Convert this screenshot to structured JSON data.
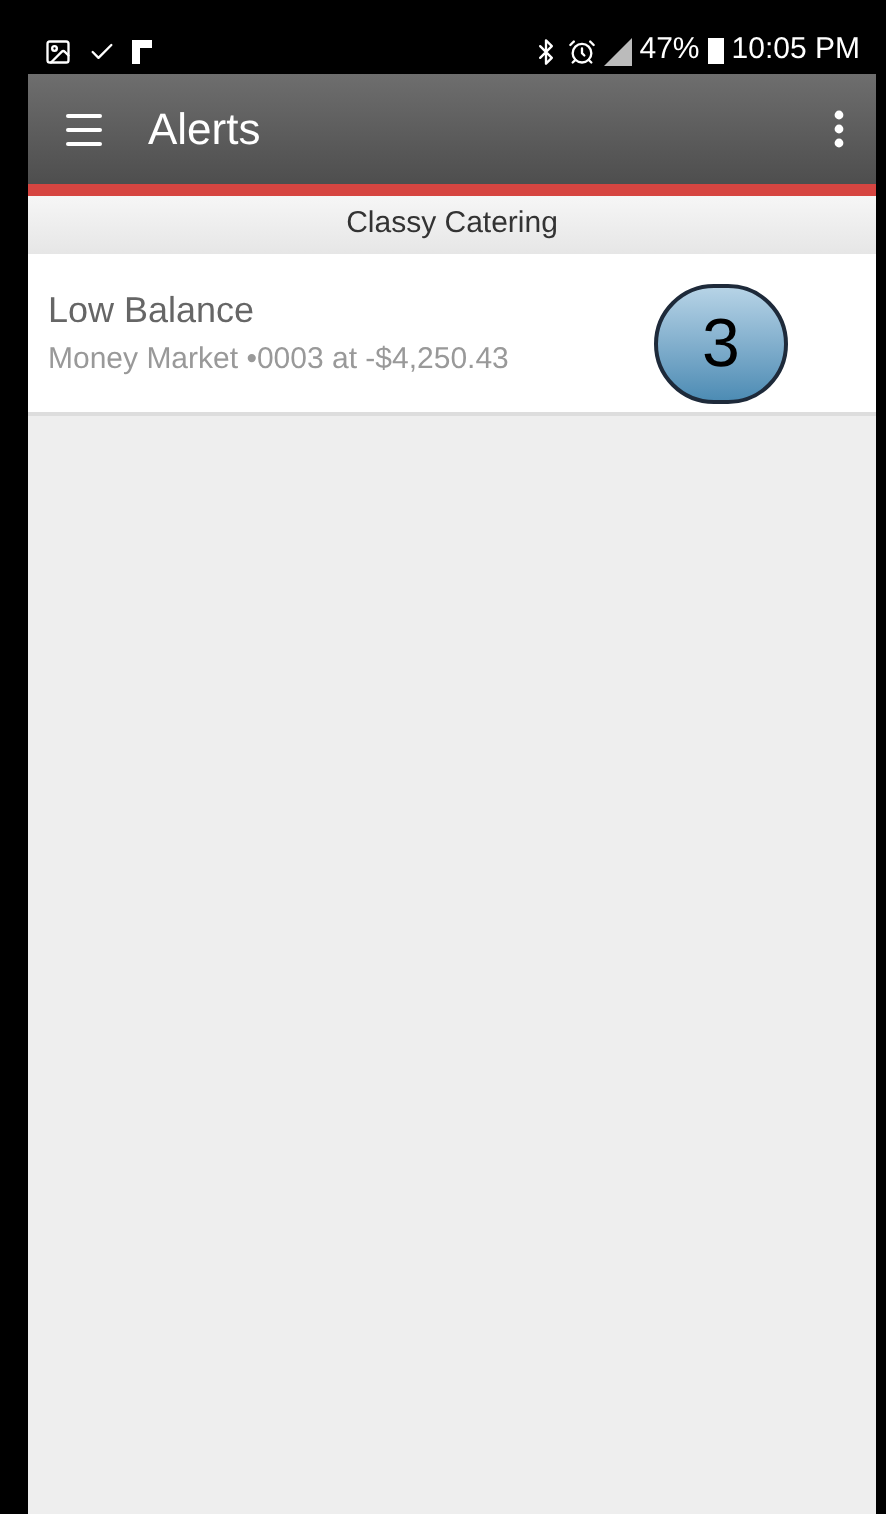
{
  "status_bar": {
    "battery": "47%",
    "time": "10:05 PM"
  },
  "toolbar": {
    "title": "Alerts"
  },
  "section": {
    "title": "Classy Catering"
  },
  "alerts": [
    {
      "title": "Low Balance",
      "detail": "Money Market •0003 at -$4,250.43",
      "callout": "3"
    }
  ]
}
